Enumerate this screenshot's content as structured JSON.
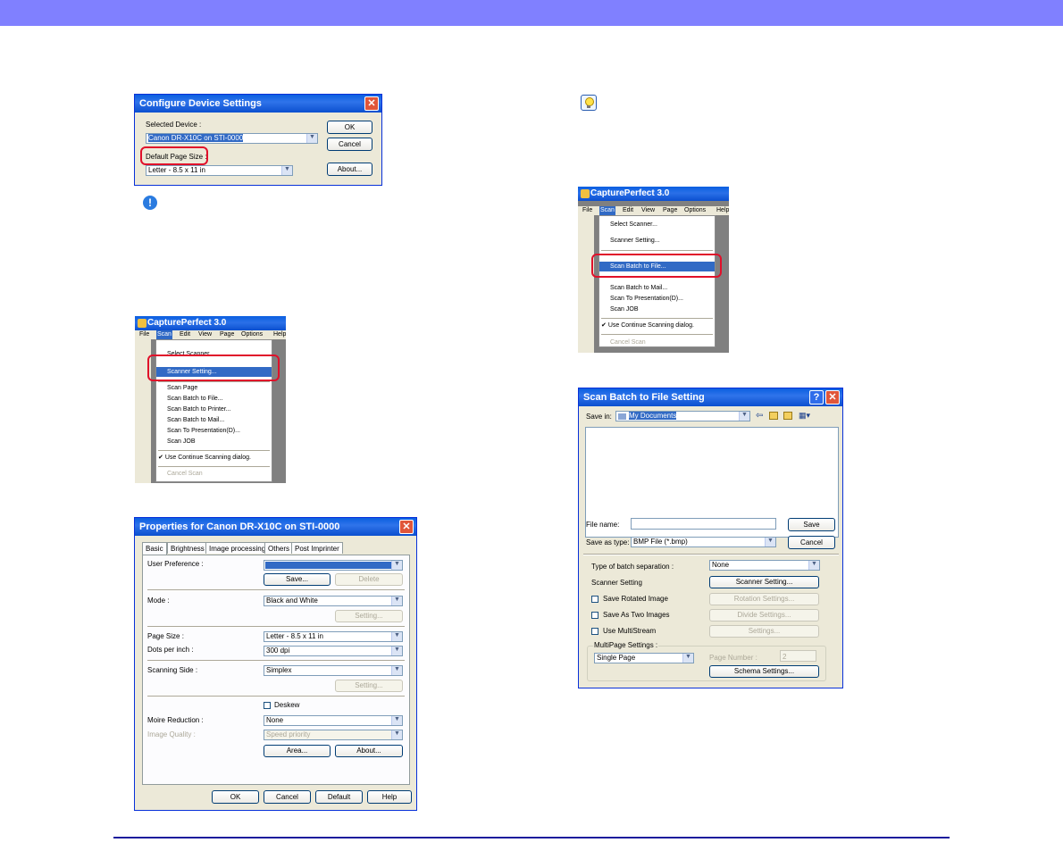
{
  "cfg": {
    "title": "Configure Device Settings",
    "selected_device_label": "Selected Device :",
    "selected_device_value": "Canon DR-X10C on STI-0000",
    "default_page_size_label": "Default Page Size :",
    "default_page_size_value": "Letter - 8.5 x 11 in",
    "ok": "OK",
    "cancel": "Cancel",
    "about": "About..."
  },
  "cp1": {
    "title": "CapturePerfect 3.0",
    "menu": [
      "File",
      "Scan",
      "Edit",
      "View",
      "Page",
      "Options",
      "Help"
    ],
    "items": [
      "Select Scanner...",
      "Scanner Setting...",
      "Scan Page",
      "Scan Batch to File...",
      "Scan Batch to Printer...",
      "Scan Batch to Mail...",
      "Scan To Presentation(D)...",
      "Scan JOB",
      "Use Continue Scanning dialog.",
      "Cancel Scan"
    ]
  },
  "cp2": {
    "title": "CapturePerfect 3.0",
    "menu": [
      "File",
      "Scan",
      "Edit",
      "View",
      "Page",
      "Options",
      "Help"
    ],
    "items": [
      "Select Scanner...",
      "Scanner Setting...",
      "Scan Batch to File...",
      "Scan Batch to Mail...",
      "Scan To Presentation(D)...",
      "Scan JOB",
      "Use Continue Scanning dialog.",
      "Cancel Scan"
    ]
  },
  "props": {
    "title": "Properties for Canon DR-X10C on STI-0000",
    "tabs": [
      "Basic",
      "Brightness",
      "Image processing",
      "Others",
      "Post Imprinter"
    ],
    "user_pref_label": "User Preference :",
    "save": "Save...",
    "delete": "Delete",
    "mode_label": "Mode :",
    "mode_value": "Black and White",
    "setting": "Setting...",
    "page_size_label": "Page Size :",
    "page_size_value": "Letter - 8.5 x 11 in",
    "dpi_label": "Dots per inch :",
    "dpi_value": "300 dpi",
    "side_label": "Scanning Side :",
    "side_value": "Simplex",
    "deskew": "Deskew",
    "moire_label": "Moire Reduction :",
    "moire_value": "None",
    "quality_label": "Image Quality :",
    "quality_value": "Speed priority",
    "area": "Area...",
    "about": "About...",
    "ok": "OK",
    "cancel": "Cancel",
    "default": "Default",
    "help": "Help"
  },
  "batch": {
    "title": "Scan Batch to File Setting",
    "save_in_label": "Save in:",
    "save_in_value": "My Documents",
    "file_name_label": "File name:",
    "file_name_value": "",
    "save_as_label": "Save as type:",
    "save_as_value": "BMP File (*.bmp)",
    "save": "Save",
    "cancel": "Cancel",
    "sep_label": "Type of batch separation :",
    "sep_value": "None",
    "scanner_setting_label": "Scanner Setting",
    "scanner_setting_btn": "Scanner Setting...",
    "save_rotated": "Save Rotated Image",
    "rotation_settings": "Rotation Settings...",
    "save_two": "Save As Two Images",
    "divide_settings": "Divide Settings...",
    "multistream": "Use MultiStream",
    "settings": "Settings...",
    "multipage_label": "MultiPage Settings :",
    "multipage_value": "Single Page",
    "page_number_label": "Page Number :",
    "page_number_value": "2",
    "schema_settings": "Schema Settings..."
  }
}
